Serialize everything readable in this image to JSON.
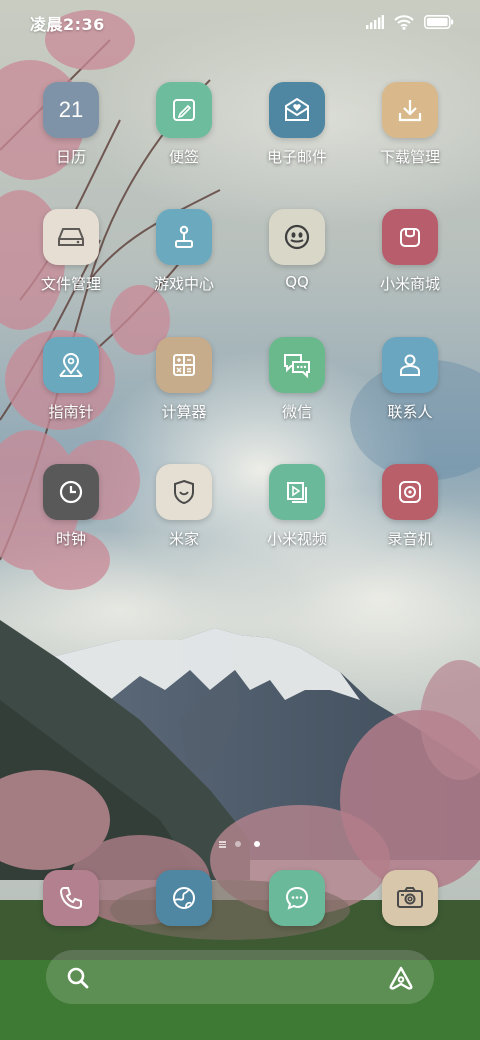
{
  "status_bar": {
    "time": "凌晨2:36",
    "icons": [
      "signal-icon",
      "wifi-icon",
      "battery-icon"
    ]
  },
  "apps": [
    [
      {
        "label": "日历",
        "icon": "calendar-icon",
        "calendar_day": "21",
        "color": "#7f93a8"
      },
      {
        "label": "便签",
        "icon": "notes-icon",
        "color": "#6dbc9e"
      },
      {
        "label": "电子邮件",
        "icon": "email-icon",
        "color": "#4f87a3"
      },
      {
        "label": "下载管理",
        "icon": "download-icon",
        "color": "#d9b98b"
      }
    ],
    [
      {
        "label": "文件管理",
        "icon": "file-drive-icon",
        "color": "#e7ded3"
      },
      {
        "label": "游戏中心",
        "icon": "joystick-icon",
        "color": "#6ba9bf"
      },
      {
        "label": "QQ",
        "icon": "qq-penguin-icon",
        "color": "#d9d7c8"
      },
      {
        "label": "小米商城",
        "icon": "shop-bag-icon",
        "color": "#b85d6c"
      }
    ],
    [
      {
        "label": "指南针",
        "icon": "map-pin-icon",
        "color": "#6aa8be"
      },
      {
        "label": "计算器",
        "icon": "calculator-icon",
        "color": "#c7ac8b"
      },
      {
        "label": "微信",
        "icon": "wechat-icon",
        "color": "#6ab98c"
      },
      {
        "label": "联系人",
        "icon": "contact-icon",
        "color": "#6aa6bf"
      }
    ],
    [
      {
        "label": "时钟",
        "icon": "clock-icon",
        "color": "#595959"
      },
      {
        "label": "米家",
        "icon": "shield-smile-icon",
        "color": "#e5dfd3"
      },
      {
        "label": "小米视频",
        "icon": "video-icon",
        "color": "#6ab99a"
      },
      {
        "label": "录音机",
        "icon": "recorder-icon",
        "color": "#b85f6a"
      }
    ]
  ],
  "page_indicator": {
    "page_count": 2,
    "active_page": 2
  },
  "dock": [
    {
      "icon": "phone-icon",
      "color": "#b2808e"
    },
    {
      "icon": "browser-icon",
      "color": "#4f87a3"
    },
    {
      "icon": "message-icon",
      "color": "#6ab99a"
    },
    {
      "icon": "camera-icon",
      "color": "#d9c7ab"
    }
  ],
  "search_bar": {
    "left_icon": "search-icon",
    "right_icon": "assistant-icon"
  }
}
